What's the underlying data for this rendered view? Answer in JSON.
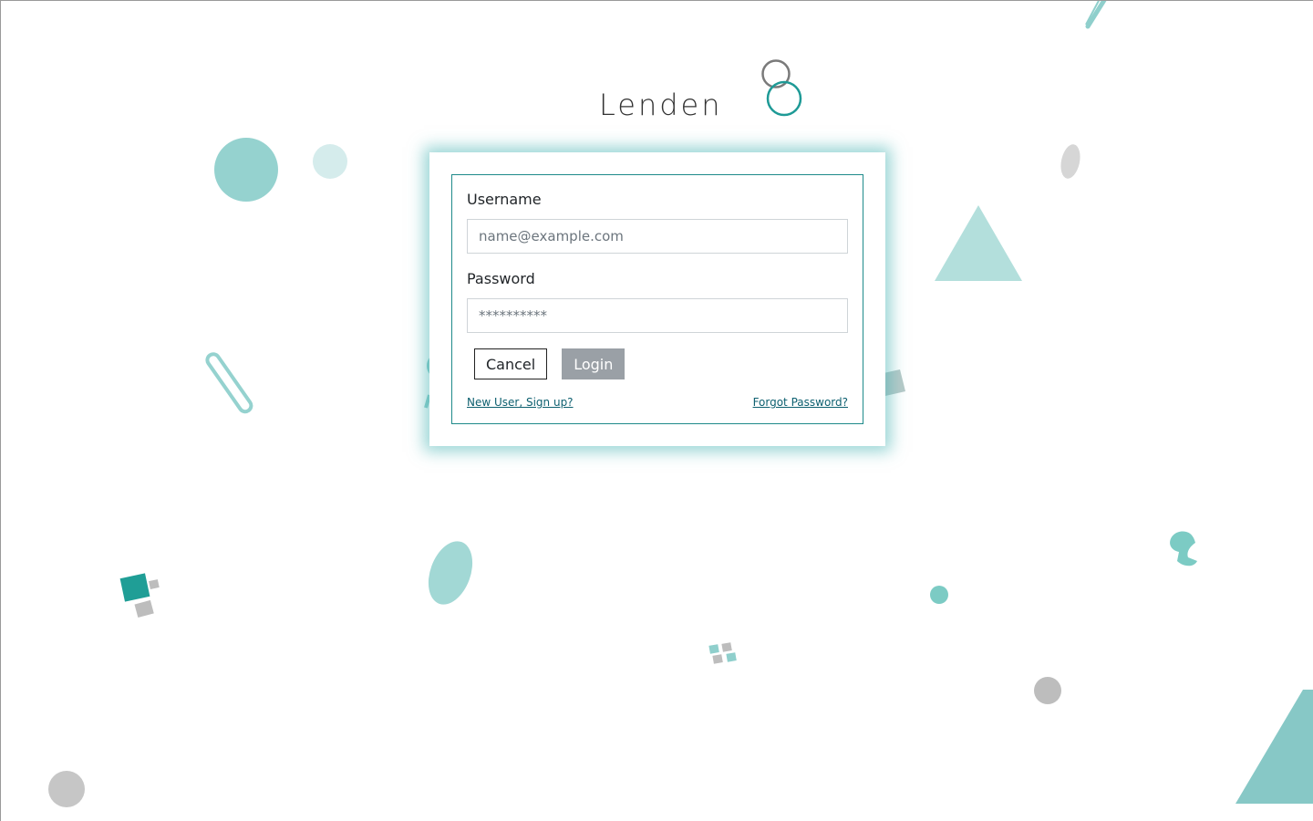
{
  "app": {
    "brand": "Lenden",
    "brand_icon": "lenden-logo-icon"
  },
  "login_form": {
    "username_label": "Username",
    "username_value": "",
    "username_placeholder": "name@example.com",
    "password_label": "Password",
    "password_value": "",
    "password_placeholder": "**********",
    "cancel_label": "Cancel",
    "login_label": "Login",
    "signup_link": "New User, Sign up?",
    "forgot_link": "Forgot Password?"
  },
  "colors": {
    "accent": "#1e8a8a",
    "teal_light": "#8fcfcc",
    "teal_dark": "#1a9a96",
    "grey_shape": "#bdbdbd",
    "login_button_bg": "#9aa0a6",
    "link": "#0e6070"
  }
}
